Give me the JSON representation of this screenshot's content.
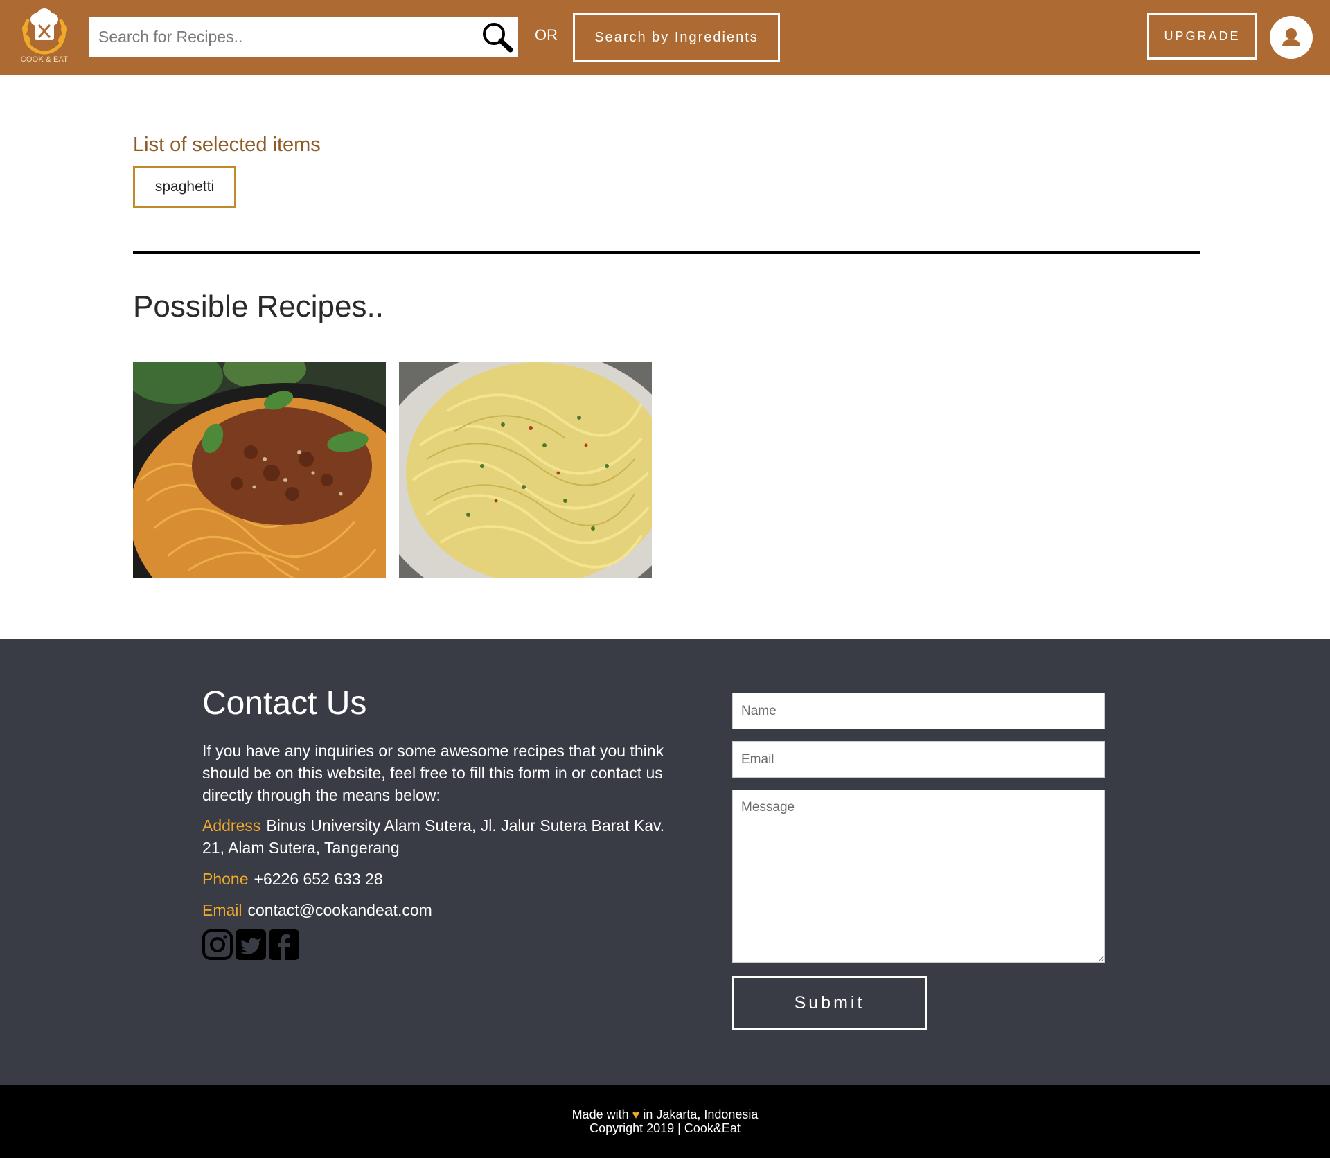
{
  "header": {
    "logo_text": "COOK & EAT",
    "search_placeholder": "Search for Recipes..",
    "or_label": "OR",
    "ingredients_button": "Search by Ingredients",
    "upgrade_button": "UPGRADE"
  },
  "selected": {
    "title": "List of selected items",
    "items": [
      "spaghetti"
    ]
  },
  "recipes": {
    "title": "Possible Recipes..",
    "cards": [
      {
        "icon": "spaghetti-bolognese-image"
      },
      {
        "icon": "spaghetti-aglio-olio-image"
      }
    ]
  },
  "contact": {
    "title": "Contact Us",
    "description": "If you have any inquiries or some awesome recipes that you think should be on this website, feel free to fill this form in or contact us directly through the means below:",
    "address_label": "Address",
    "address_value": "Binus University Alam Sutera, Jl. Jalur Sutera Barat Kav. 21, Alam Sutera, Tangerang",
    "phone_label": "Phone",
    "phone_value": "+6226 652 633 28",
    "email_label": "Email",
    "email_value": "contact@cookandeat.com",
    "socials": [
      "instagram-icon",
      "twitter-icon",
      "facebook-icon"
    ],
    "form": {
      "name_placeholder": "Name",
      "email_placeholder": "Email",
      "message_placeholder": "Message",
      "submit_label": "Submit"
    }
  },
  "footer": {
    "made_with_prefix": "Made with",
    "made_with_suffix": "in Jakarta, Indonesia",
    "copyright": "Copyright 2019 | Cook&Eat"
  },
  "colors": {
    "header_bg": "#ad6b33",
    "accent": "#f0a92a",
    "contact_bg": "#393c44",
    "footer_bg": "#000000"
  }
}
